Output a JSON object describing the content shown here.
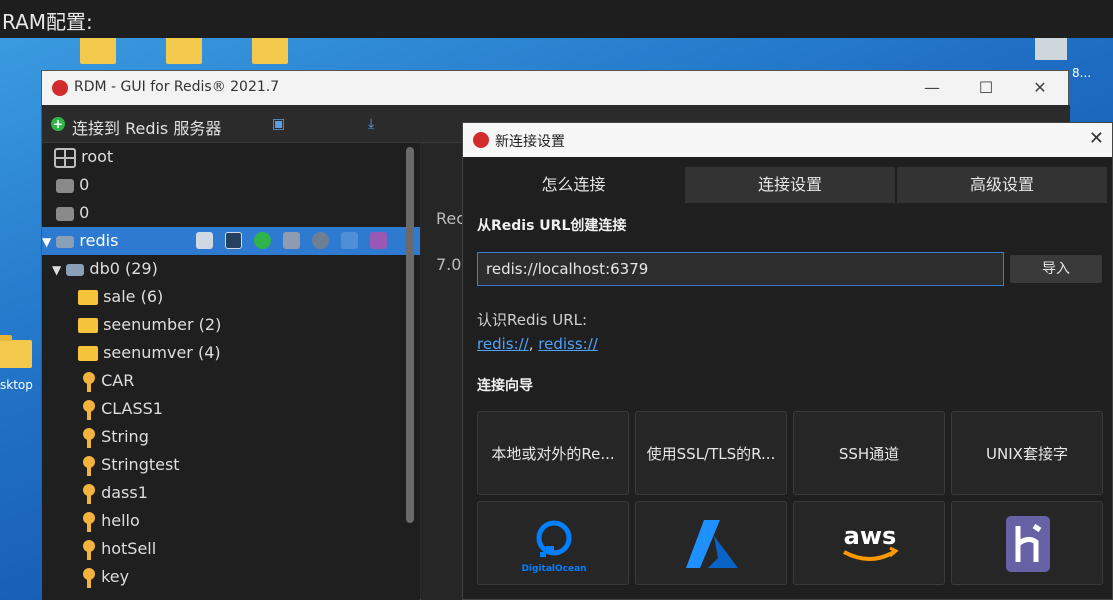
{
  "caption": "RAM配置:",
  "desktop": {
    "label_left": "sktop",
    "label_right": "8..."
  },
  "window": {
    "title": "RDM - GUI for Redis® 2021.7",
    "min": "—",
    "max": "☐",
    "close": "✕"
  },
  "left": {
    "connect_label": "连接到 Redis 服务器",
    "plus": "+",
    "tree": {
      "root": "root",
      "db_a": "0",
      "db_b": "0",
      "redis": "redis",
      "db0": "db0  (29)",
      "folders": [
        "sale (6)",
        "seenumber (2)",
        "seenumver (4)"
      ],
      "keys": [
        "CAR",
        "CLASS1",
        "String",
        "Stringtest",
        "dass1",
        "hello",
        "hotSell",
        "key"
      ]
    }
  },
  "right": {
    "peek1": "Rec",
    "peek2": "7.0."
  },
  "dialog": {
    "title": "新连接设置",
    "close": "✕",
    "tabs": [
      "怎么连接",
      "连接设置",
      "高级设置"
    ],
    "section_url": "从Redis URL创建连接",
    "url_value": "redis://localhost:6379",
    "import": "导入",
    "learn": "认识Redis URL:",
    "link1": "redis://",
    "link_sep": ", ",
    "link2": "rediss://",
    "section_wizard": "连接向导",
    "cards": [
      "本地或对外的Re...",
      "使用SSL/TLS的R...",
      "SSH通道",
      "UNIX套接字"
    ],
    "provider_labels": {
      "digitalocean": "DigitalOcean",
      "aws": "aws"
    }
  },
  "colors": {
    "accent": "#2f7ad1",
    "folder": "#f5c43a",
    "key": "#f3b33d",
    "link": "#4ea3ff"
  }
}
